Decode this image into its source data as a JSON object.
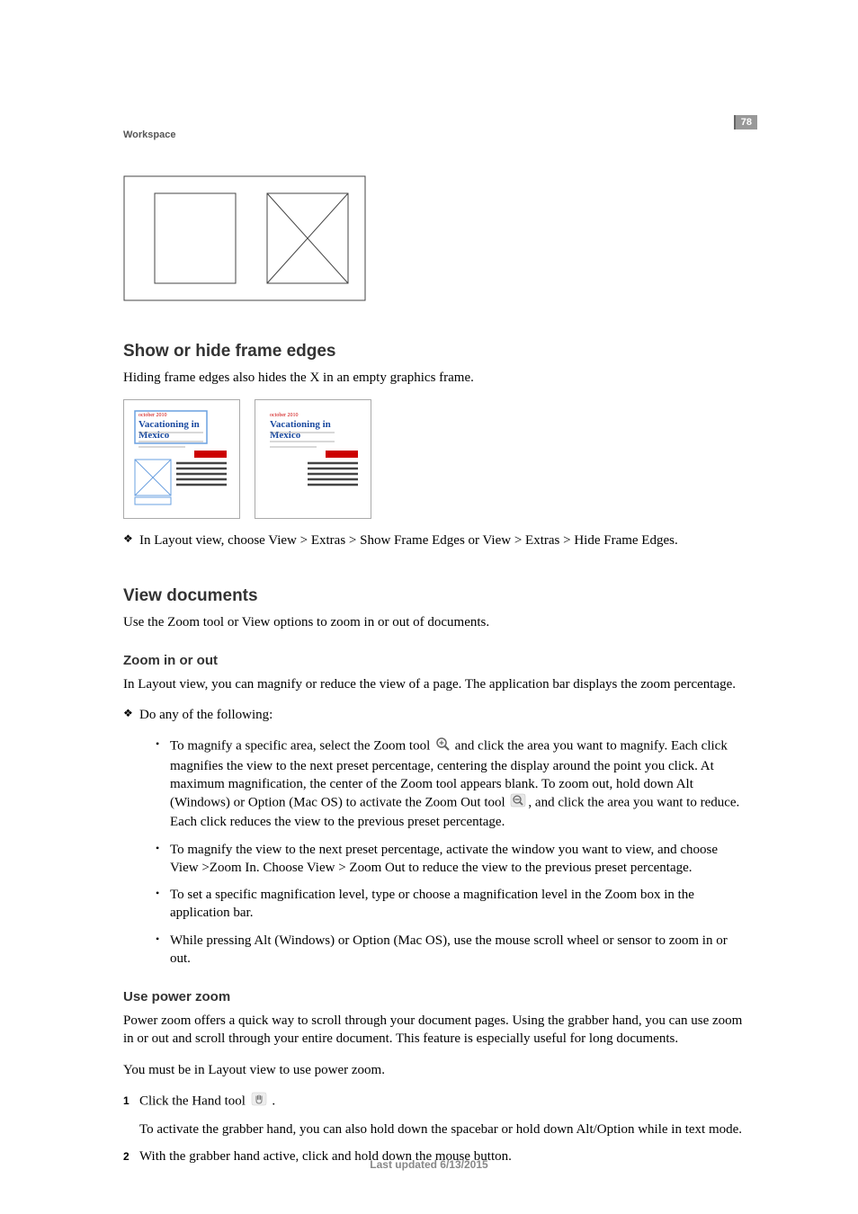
{
  "page_number": "78",
  "section_label": "Workspace",
  "heading_frame": "Show or hide frame edges",
  "frame_body": "Hiding frame edges also hides the X in an empty graphics frame.",
  "frame_bullet": "In Layout view, choose View > Extras > Show Frame Edges or View > Extras > Hide Frame Edges.",
  "heading_view": "View documents",
  "view_body": "Use the Zoom tool or View options to zoom in or out of documents.",
  "heading_zoom": "Zoom in or out",
  "zoom_body": "In Layout view, you can magnify or reduce the view of a page. The application bar displays the zoom percentage.",
  "zoom_intro": "Do any of the following:",
  "zoom_item1_a": "To magnify a specific area, select the Zoom tool ",
  "zoom_item1_b": " and click the area you want to magnify. Each click magnifies the view to the next preset percentage, centering the display around the point you click. At maximum magnification, the center of the Zoom tool appears blank. To zoom out, hold down Alt (Windows) or Option (Mac OS) to activate the Zoom Out tool ",
  "zoom_item1_c": ", and click the area you want to reduce. Each click reduces the view to the previous preset percentage.",
  "zoom_item2": "To magnify the view to the next preset percentage, activate the window you want to view, and choose View >Zoom In. Choose View > Zoom Out to reduce the view to the previous preset percentage.",
  "zoom_item3": "To set a specific magnification level, type or choose a magnification level in the Zoom box in the application bar.",
  "zoom_item4": "While pressing Alt (Windows) or Option (Mac OS), use the mouse scroll wheel or sensor to zoom in or out.",
  "heading_power": "Use power zoom",
  "power_body": "Power zoom offers a quick way to scroll through your document pages. Using the grabber hand, you can use zoom in or out and scroll through your entire document. This feature is especially useful for long documents.",
  "power_note": "You must be in Layout view to use power zoom.",
  "power_step1_a": "Click the Hand tool ",
  "power_step1_b": " .",
  "power_step1_sub": "To activate the grabber hand, you can also hold down the spacebar or hold down Alt/Option while in text mode.",
  "power_step2": "With the grabber hand active, click and hold down the mouse button.",
  "footer": "Last updated 6/13/2015",
  "thumb_title": "Vacationing in",
  "thumb_subtitle": "Mexico"
}
